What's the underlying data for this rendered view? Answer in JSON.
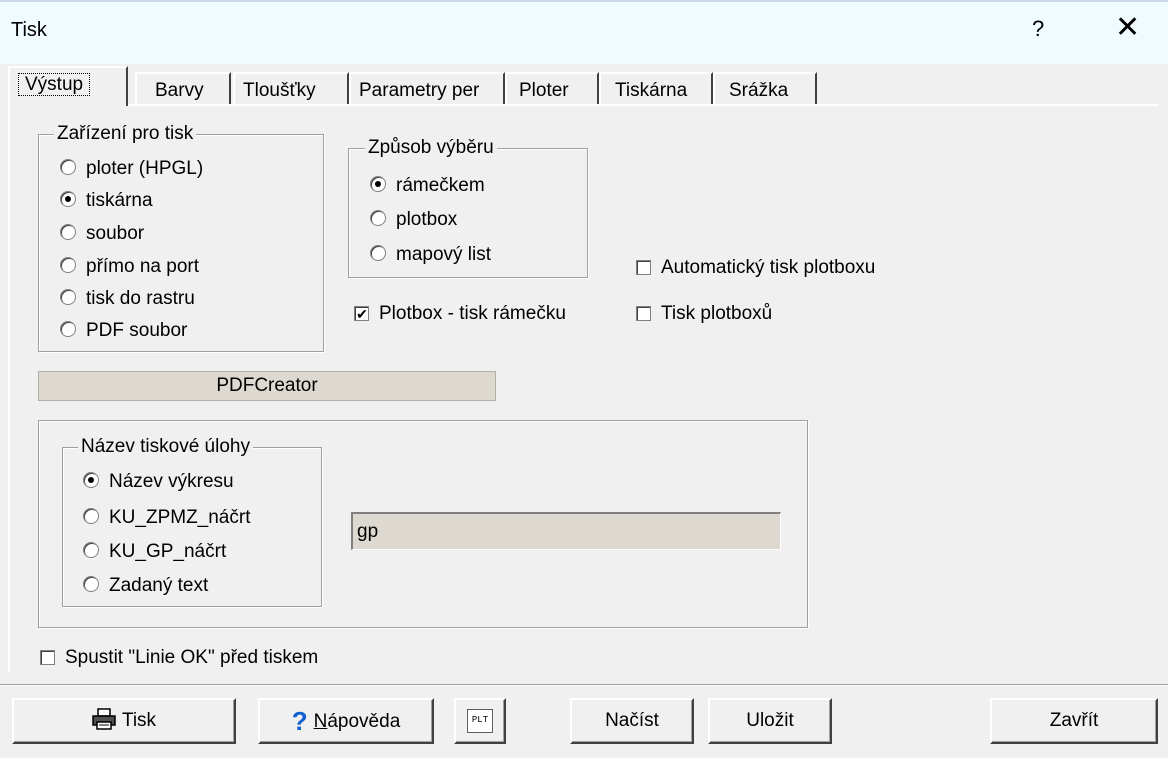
{
  "window": {
    "title": "Tisk",
    "help_glyph": "?",
    "close_glyph": "✕"
  },
  "tabs": [
    {
      "label": "Výstup",
      "active": true
    },
    {
      "label": "Barvy"
    },
    {
      "label": "Tloušťky"
    },
    {
      "label": "Parametry per"
    },
    {
      "label": "Ploter"
    },
    {
      "label": "Tiskárna"
    },
    {
      "label": "Srážka"
    }
  ],
  "device_group": {
    "legend": "Zařízení pro tisk",
    "options": [
      "ploter (HPGL)",
      "tiskárna",
      "soubor",
      "přímo na port",
      "tisk do rastru",
      "PDF soubor"
    ],
    "selected": "tiskárna"
  },
  "selection_group": {
    "legend": "Způsob výběru",
    "options": [
      "rámečkem",
      "plotbox",
      "mapový list"
    ],
    "selected": "rámečkem"
  },
  "checkboxes": {
    "plotbox_frame": {
      "label": "Plotbox - tisk rámečku",
      "checked": true
    },
    "auto_plotbox": {
      "label": "Automatický tisk plotboxu",
      "checked": false
    },
    "print_plotboxes": {
      "label": "Tisk plotboxů",
      "checked": false
    },
    "run_lines_ok": {
      "label": "Spustit \"Linie OK\" před tiskem",
      "checked": false
    }
  },
  "printer_name": "PDFCreator",
  "jobname_group": {
    "legend": "Název tiskové úlohy",
    "options": [
      "Název výkresu",
      "KU_ZPMZ_náčrt",
      "KU_GP_náčrt",
      "Zadaný text"
    ],
    "selected": "Název výkresu",
    "text_value": "gp"
  },
  "buttons": {
    "print": "Tisk",
    "help_prefix": "N",
    "help_rest": "ápověda",
    "plt": "PLT",
    "load": "Načíst",
    "save": "Uložit",
    "close": "Zavřít"
  },
  "icons": {
    "printer": "printer-icon",
    "help": "question-icon",
    "plt": "plt-file-icon"
  }
}
